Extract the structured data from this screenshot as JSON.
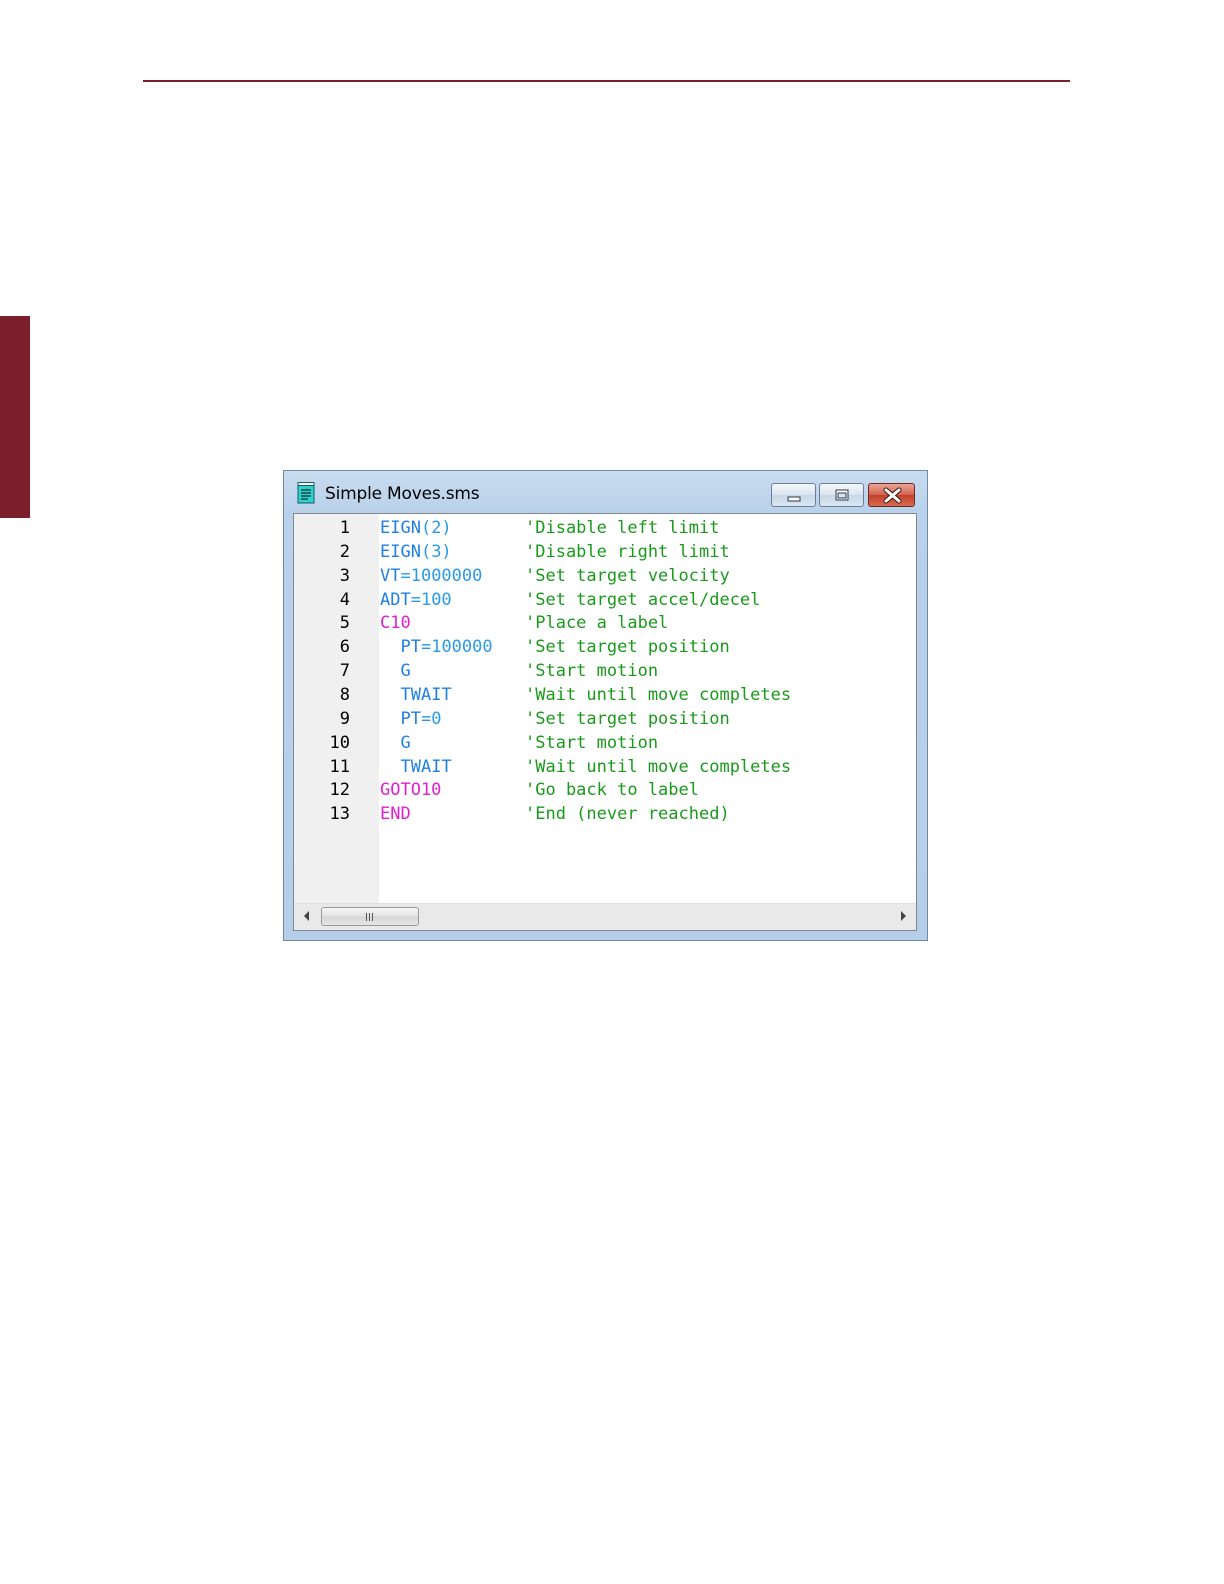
{
  "window": {
    "title": "Simple Moves.sms",
    "icon": "document-icon",
    "buttons": {
      "minimize": "minimize-icon",
      "maximize": "maximize-icon",
      "close": "close-icon"
    }
  },
  "editor": {
    "lines": [
      {
        "num": "1",
        "indent": "",
        "parts": [
          {
            "t": "EIGN",
            "c": "cmd"
          },
          {
            "t": "(2)",
            "c": "num"
          }
        ],
        "comment": "'Disable left limit"
      },
      {
        "num": "2",
        "indent": "",
        "parts": [
          {
            "t": "EIGN",
            "c": "cmd"
          },
          {
            "t": "(3)",
            "c": "num"
          }
        ],
        "comment": "'Disable right limit"
      },
      {
        "num": "3",
        "indent": "",
        "parts": [
          {
            "t": "VT",
            "c": "cmd"
          },
          {
            "t": "=1000000",
            "c": "num"
          }
        ],
        "comment": "'Set target velocity"
      },
      {
        "num": "4",
        "indent": "",
        "parts": [
          {
            "t": "ADT",
            "c": "cmd"
          },
          {
            "t": "=100",
            "c": "num"
          }
        ],
        "comment": "'Set target accel/decel"
      },
      {
        "num": "5",
        "indent": "",
        "parts": [
          {
            "t": "C10",
            "c": "lbl"
          }
        ],
        "comment": "'Place a label"
      },
      {
        "num": "6",
        "indent": "  ",
        "parts": [
          {
            "t": "PT",
            "c": "cmd"
          },
          {
            "t": "=100000",
            "c": "num"
          }
        ],
        "comment": "'Set target position"
      },
      {
        "num": "7",
        "indent": "  ",
        "parts": [
          {
            "t": "G",
            "c": "cmd"
          }
        ],
        "comment": "'Start motion"
      },
      {
        "num": "8",
        "indent": "  ",
        "parts": [
          {
            "t": "TWAIT",
            "c": "cmd"
          }
        ],
        "comment": "'Wait until move completes"
      },
      {
        "num": "9",
        "indent": "  ",
        "parts": [
          {
            "t": "PT",
            "c": "cmd"
          },
          {
            "t": "=0",
            "c": "num"
          }
        ],
        "comment": "'Set target position"
      },
      {
        "num": "10",
        "indent": "  ",
        "parts": [
          {
            "t": "G",
            "c": "cmd"
          }
        ],
        "comment": "'Start motion"
      },
      {
        "num": "11",
        "indent": "  ",
        "parts": [
          {
            "t": "TWAIT",
            "c": "cmd"
          }
        ],
        "comment": "'Wait until move completes"
      },
      {
        "num": "12",
        "indent": "",
        "parts": [
          {
            "t": "GOTO10",
            "c": "lbl"
          }
        ],
        "comment": "'Go back to label"
      },
      {
        "num": "13",
        "indent": "",
        "parts": [
          {
            "t": "END",
            "c": "lbl"
          }
        ],
        "comment": "'End (never reached)"
      }
    ]
  },
  "scrollbar": {
    "grip": "III"
  }
}
